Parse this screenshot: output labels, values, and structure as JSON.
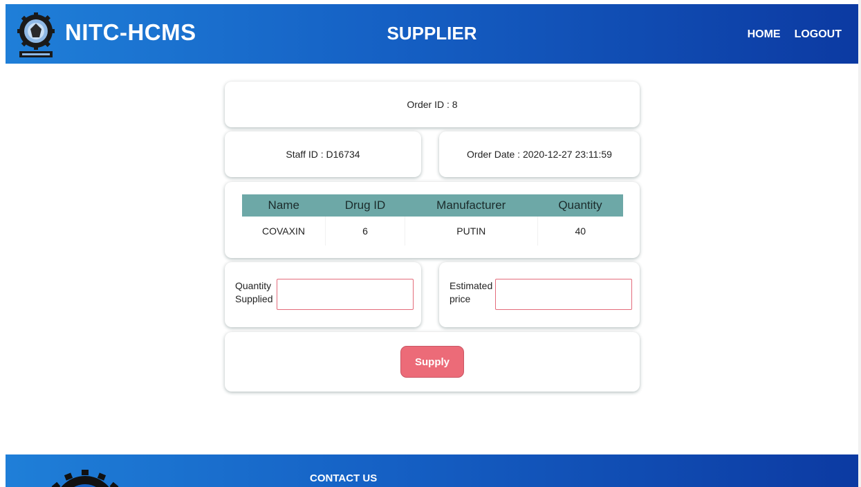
{
  "header": {
    "brand": "NITC-HCMS",
    "page_title": "SUPPLIER",
    "nav": {
      "home": "HOME",
      "logout": "LOGOUT"
    },
    "logo_icon": "institute-emblem-icon"
  },
  "order": {
    "order_id": "Order ID : 8",
    "staff_id": "Staff ID : D16734",
    "order_date": "Order Date : 2020-12-27 23:11:59"
  },
  "table": {
    "columns": [
      "Name",
      "Drug ID",
      "Manufacturer",
      "Quantity"
    ],
    "rows": [
      [
        "COVAXIN",
        "6",
        "PUTIN",
        "40"
      ]
    ]
  },
  "form": {
    "quantity_label_line1": "Quantity",
    "quantity_label_line2": "Supplied",
    "quantity_value": "",
    "price_label_line1": "Estimated",
    "price_label_line2": "price",
    "price_value": "",
    "supply_button": "Supply"
  },
  "footer": {
    "contact": "CONTACT US",
    "logo_icon": "institute-seal-icon"
  },
  "colors": {
    "header_start": "#1f7fd8",
    "header_end": "#0c3aa2",
    "table_header": "#6da8a7",
    "button": "#ec6b78",
    "input_border": "#e36b7a"
  }
}
